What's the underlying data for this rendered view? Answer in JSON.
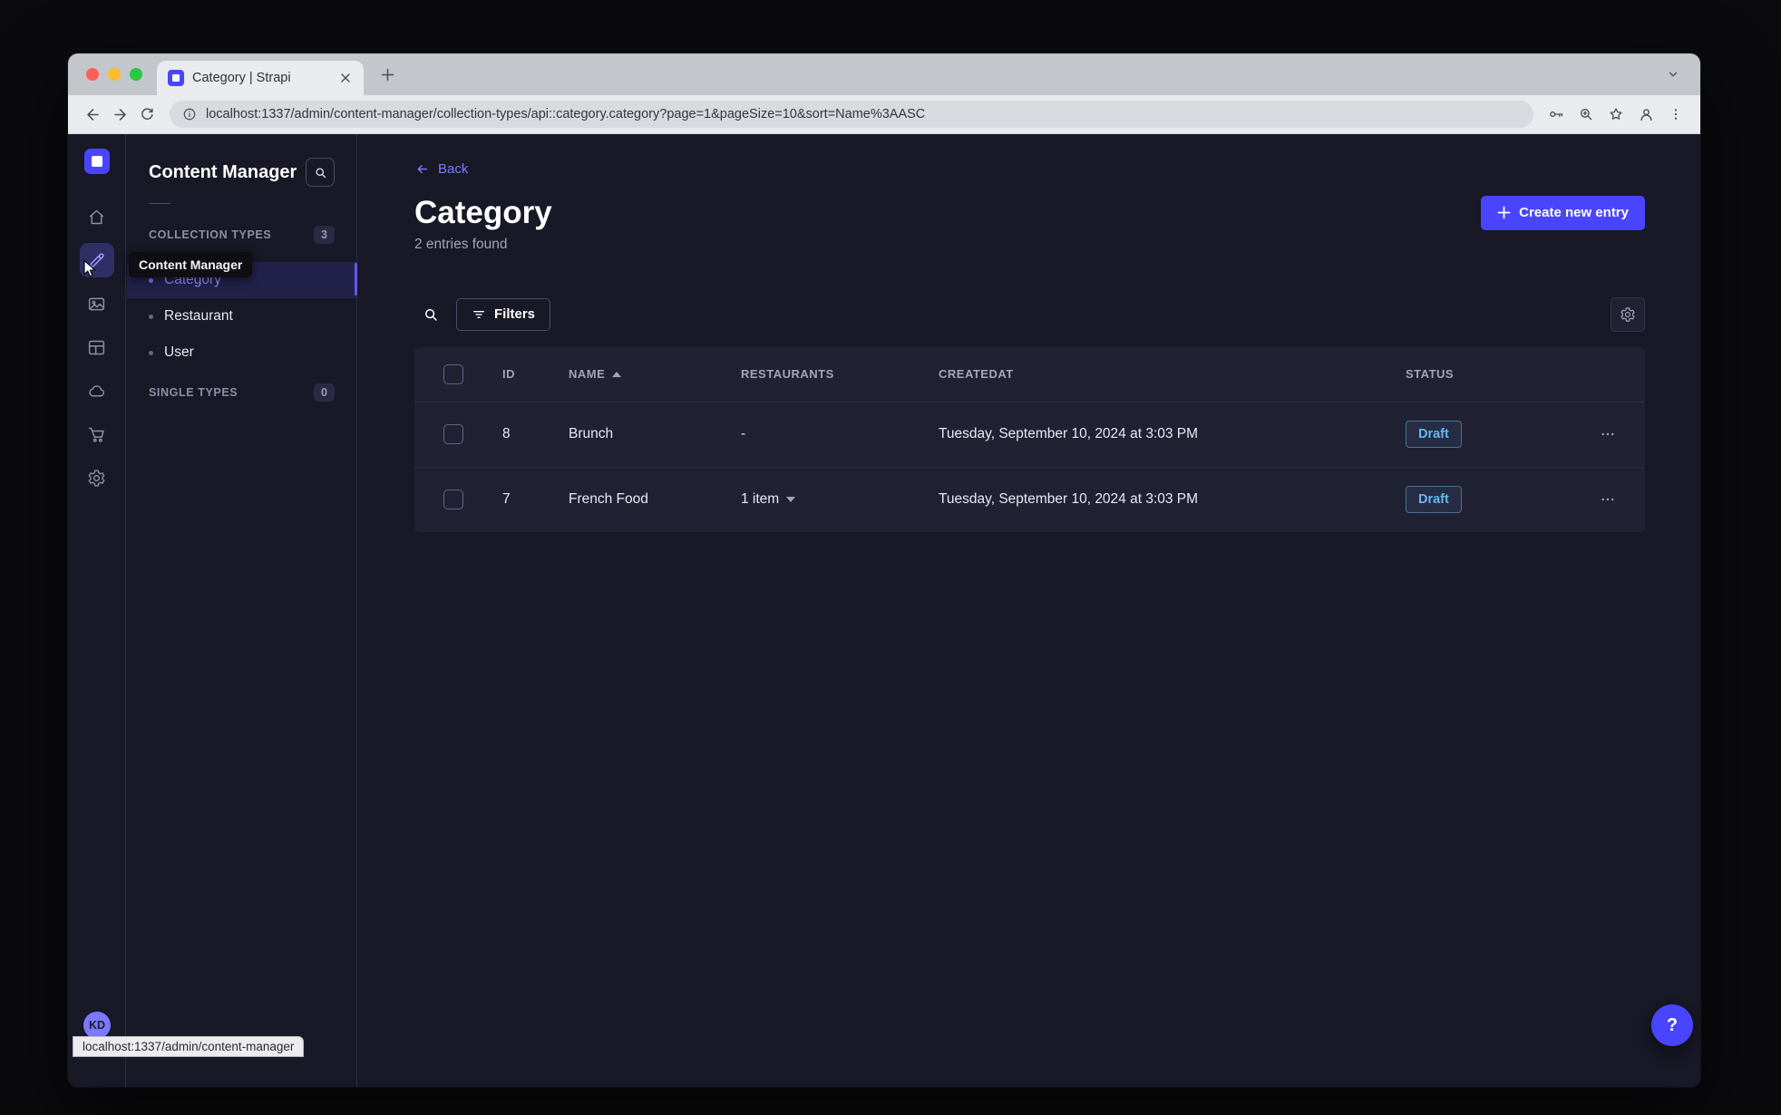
{
  "browser": {
    "tab_title": "Category | Strapi",
    "url": "localhost:1337/admin/content-manager/collection-types/api::category.category?page=1&pageSize=10&sort=Name%3AASC",
    "link_preview": "localhost:1337/admin/content-manager"
  },
  "nav": {
    "tooltip": "Content Manager",
    "avatar_initials": "KD",
    "help_label": "?"
  },
  "sidebar": {
    "title": "Content Manager",
    "collection_types_label": "COLLECTION TYPES",
    "collection_types_count": "3",
    "single_types_label": "SINGLE TYPES",
    "single_types_count": "0",
    "items": [
      {
        "label": "Category"
      },
      {
        "label": "Restaurant"
      },
      {
        "label": "User"
      }
    ]
  },
  "main": {
    "back_label": "Back",
    "title": "Category",
    "subtitle": "2 entries found",
    "create_button_label": "Create new entry",
    "filters_label": "Filters",
    "table": {
      "headers": {
        "id": "ID",
        "name": "NAME",
        "restaurants": "RESTAURANTS",
        "createdat": "CREATEDAT",
        "status": "STATUS"
      },
      "rows": [
        {
          "id": "8",
          "name": "Brunch",
          "restaurants": "-",
          "createdat": "Tuesday, September 10, 2024 at 3:03 PM",
          "status": "Draft"
        },
        {
          "id": "7",
          "name": "French Food",
          "restaurants": "1 item",
          "createdat": "Tuesday, September 10, 2024 at 3:03 PM",
          "status": "Draft"
        }
      ]
    }
  },
  "colors": {
    "primary": "#4945ff",
    "primary_text": "#7b79ff",
    "app_background": "#181826",
    "card_background": "#212134",
    "border": "#32324d",
    "draft_status": "#66b7f1"
  }
}
